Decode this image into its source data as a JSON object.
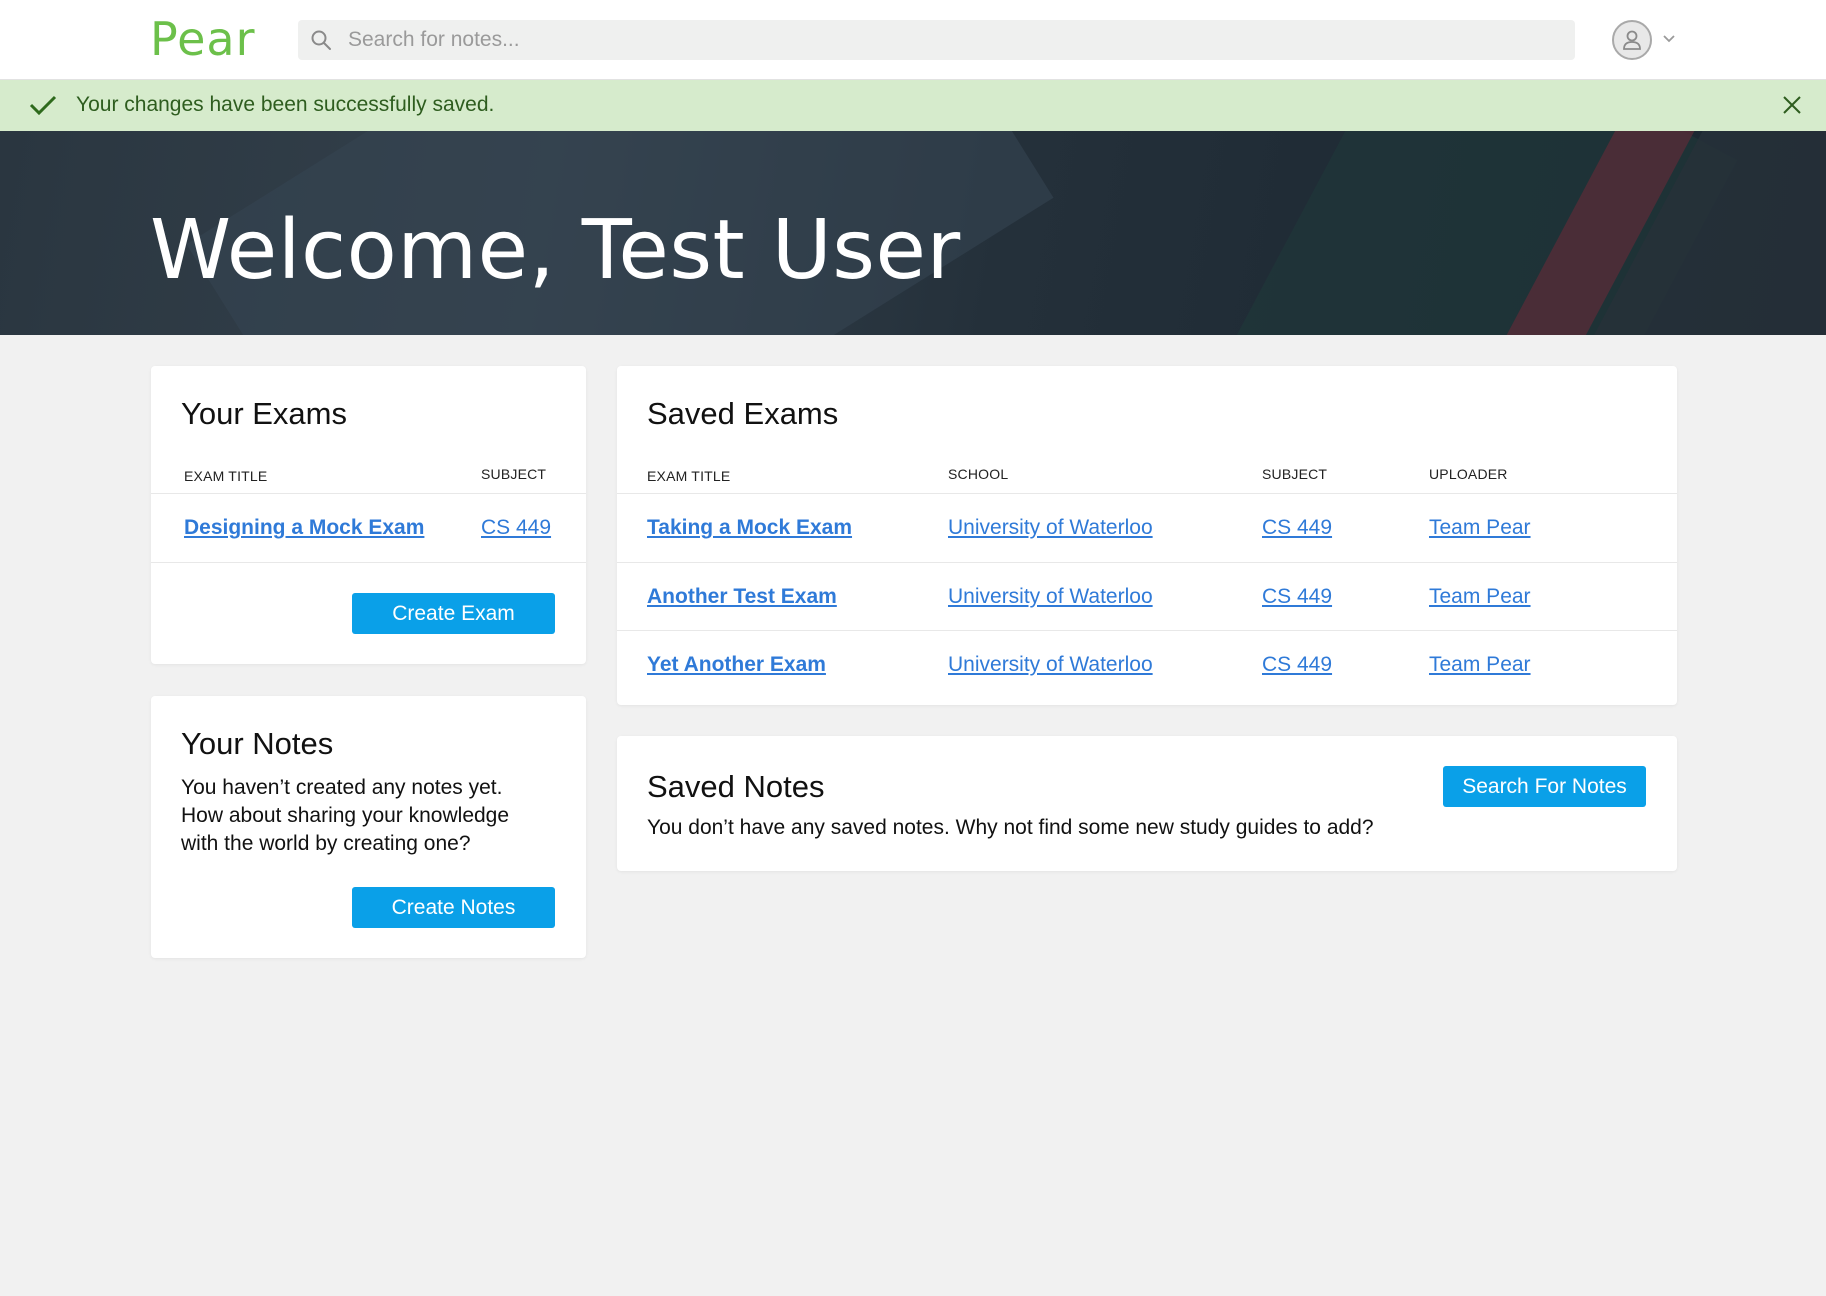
{
  "header": {
    "logo": "Pear",
    "search_placeholder": "Search for notes..."
  },
  "alert": {
    "message": "Your changes have been successfully saved."
  },
  "hero": {
    "title": "Welcome, Test User"
  },
  "your_exams": {
    "title": "Your Exams",
    "columns": [
      "EXAM TITLE",
      "SUBJECT"
    ],
    "rows": [
      {
        "title": "Designing a Mock Exam",
        "subject": "CS 449"
      }
    ],
    "button": "Create Exam"
  },
  "your_notes": {
    "title": "Your Notes",
    "lines": [
      "You haven’t created any notes yet.",
      "How about sharing your knowledge",
      "with the world by creating one?"
    ],
    "button": "Create Notes"
  },
  "saved_exams": {
    "title": "Saved Exams",
    "columns": [
      "EXAM TITLE",
      "SCHOOL",
      "SUBJECT",
      "UPLOADER"
    ],
    "rows": [
      {
        "title": "Taking a Mock Exam",
        "school": "University of Waterloo",
        "subject": "CS 449",
        "uploader": "Team Pear"
      },
      {
        "title": "Another Test Exam",
        "school": "University of Waterloo",
        "subject": "CS 449",
        "uploader": "Team Pear"
      },
      {
        "title": "Yet Another Exam",
        "school": "University of Waterloo",
        "subject": "CS 449",
        "uploader": "Team Pear"
      }
    ]
  },
  "saved_notes": {
    "title": "Saved Notes",
    "text": "You don’t have any saved notes. Why not find some new study guides to add?",
    "button": "Search For Notes"
  },
  "colors": {
    "brand_green": "#6cc04a",
    "button_blue": "#0aa0e8",
    "link_blue": "#2f7ad8",
    "alert_bg": "#d6ebcc"
  },
  "icons": [
    "search-icon",
    "user-icon",
    "chevron-down-icon",
    "check-icon",
    "close-icon"
  ]
}
